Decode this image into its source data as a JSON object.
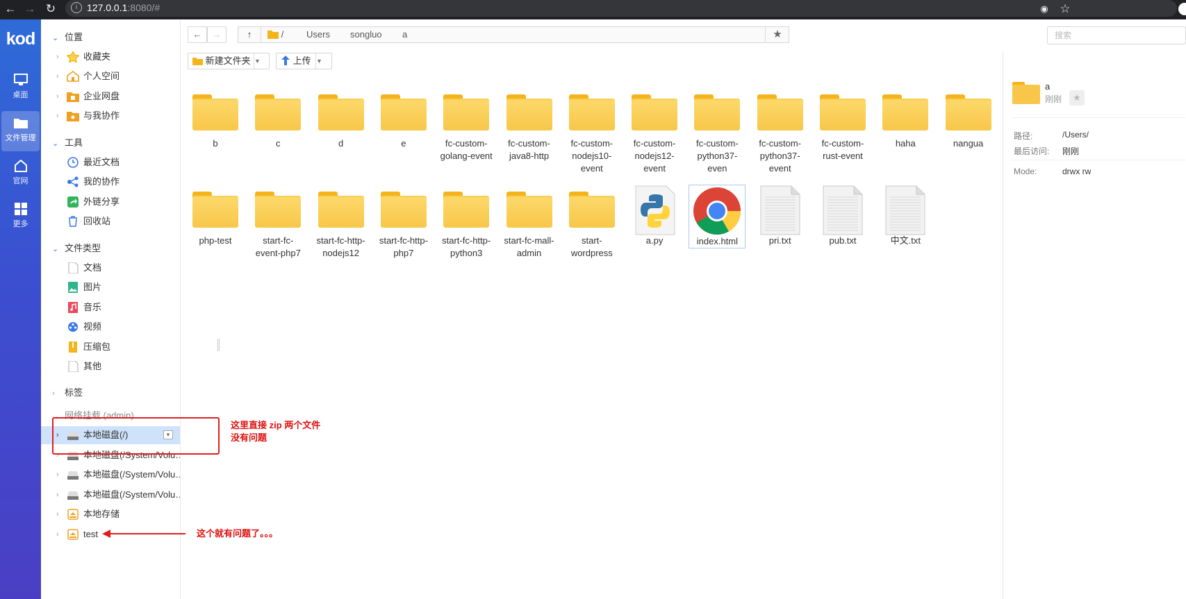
{
  "browser": {
    "url_host": "127.0.0.1",
    "url_rest": ":8080/#"
  },
  "rail": {
    "logo": "kod",
    "items": [
      {
        "label": "桌面"
      },
      {
        "label": "文件管理"
      },
      {
        "label": "官网"
      },
      {
        "label": "更多"
      }
    ]
  },
  "tree": {
    "sections": [
      {
        "label": "位置"
      },
      {
        "label": "工具"
      },
      {
        "label": "文件类型"
      },
      {
        "label": "标签"
      },
      {
        "label": "网络挂载 (admin)"
      }
    ],
    "location_items": [
      "收藏夹",
      "个人空间",
      "企业网盘",
      "与我协作"
    ],
    "tool_items": [
      "最近文档",
      "我的协作",
      "外链分享",
      "回收站"
    ],
    "type_items": [
      "文档",
      "图片",
      "音乐",
      "视频",
      "压缩包",
      "其他"
    ],
    "mount_items": [
      "本地磁盘(/)",
      "本地磁盘(/System/Volu…",
      "本地磁盘(/System/Volu…",
      "本地磁盘(/System/Volu…",
      "本地存储",
      "test"
    ]
  },
  "toolbar": {
    "breadcrumbs": [
      "/",
      "Users",
      "songluo",
      "a"
    ],
    "new_folder": "新建文件夹",
    "upload": "上传",
    "search_placeholder": "搜索"
  },
  "files": [
    {
      "name": "b",
      "kind": "folder"
    },
    {
      "name": "c",
      "kind": "folder"
    },
    {
      "name": "d",
      "kind": "folder"
    },
    {
      "name": "e",
      "kind": "folder"
    },
    {
      "name": "fc-custom-golang-event",
      "kind": "folder"
    },
    {
      "name": "fc-custom-java8-http",
      "kind": "folder"
    },
    {
      "name": "fc-custom-nodejs10-event",
      "kind": "folder"
    },
    {
      "name": "fc-custom-nodejs12-event",
      "kind": "folder"
    },
    {
      "name": "fc-custom-python37-even",
      "kind": "folder"
    },
    {
      "name": "fc-custom-python37-event",
      "kind": "folder"
    },
    {
      "name": "fc-custom-rust-event",
      "kind": "folder"
    },
    {
      "name": "haha",
      "kind": "folder"
    },
    {
      "name": "nangua",
      "kind": "folder"
    },
    {
      "name": "php-test",
      "kind": "folder"
    },
    {
      "name": "start-fc-event-php7",
      "kind": "folder"
    },
    {
      "name": "start-fc-http-nodejs12",
      "kind": "folder"
    },
    {
      "name": "start-fc-http-php7",
      "kind": "folder"
    },
    {
      "name": "start-fc-http-python3",
      "kind": "folder"
    },
    {
      "name": "start-fc-mall-admin",
      "kind": "folder"
    },
    {
      "name": "start-wordpress",
      "kind": "folder"
    },
    {
      "name": "a.py",
      "kind": "python"
    },
    {
      "name": "index.html",
      "kind": "chrome"
    },
    {
      "name": "pri.txt",
      "kind": "txt"
    },
    {
      "name": "pub.txt",
      "kind": "txt"
    },
    {
      "name": "中文.txt",
      "kind": "txt"
    }
  ],
  "detail": {
    "name": "a",
    "time": "刚刚",
    "path_label": "路径:",
    "path_value": "/Users/",
    "access_label": "最后访问:",
    "access_value": "刚刚",
    "mode_label": "Mode:",
    "mode_value": "drwx rw"
  },
  "annotations": {
    "note1_line1": "这里直接 zip 两个文件",
    "note1_line2": "没有问题",
    "note2": "这个就有问题了。。。"
  },
  "colors": {
    "rail_top": "#2e6bd8",
    "rail_bottom": "#4a3fc4",
    "accent": "#3b78e7",
    "annotation": "#e21b1b",
    "folder": "#f8c749"
  }
}
